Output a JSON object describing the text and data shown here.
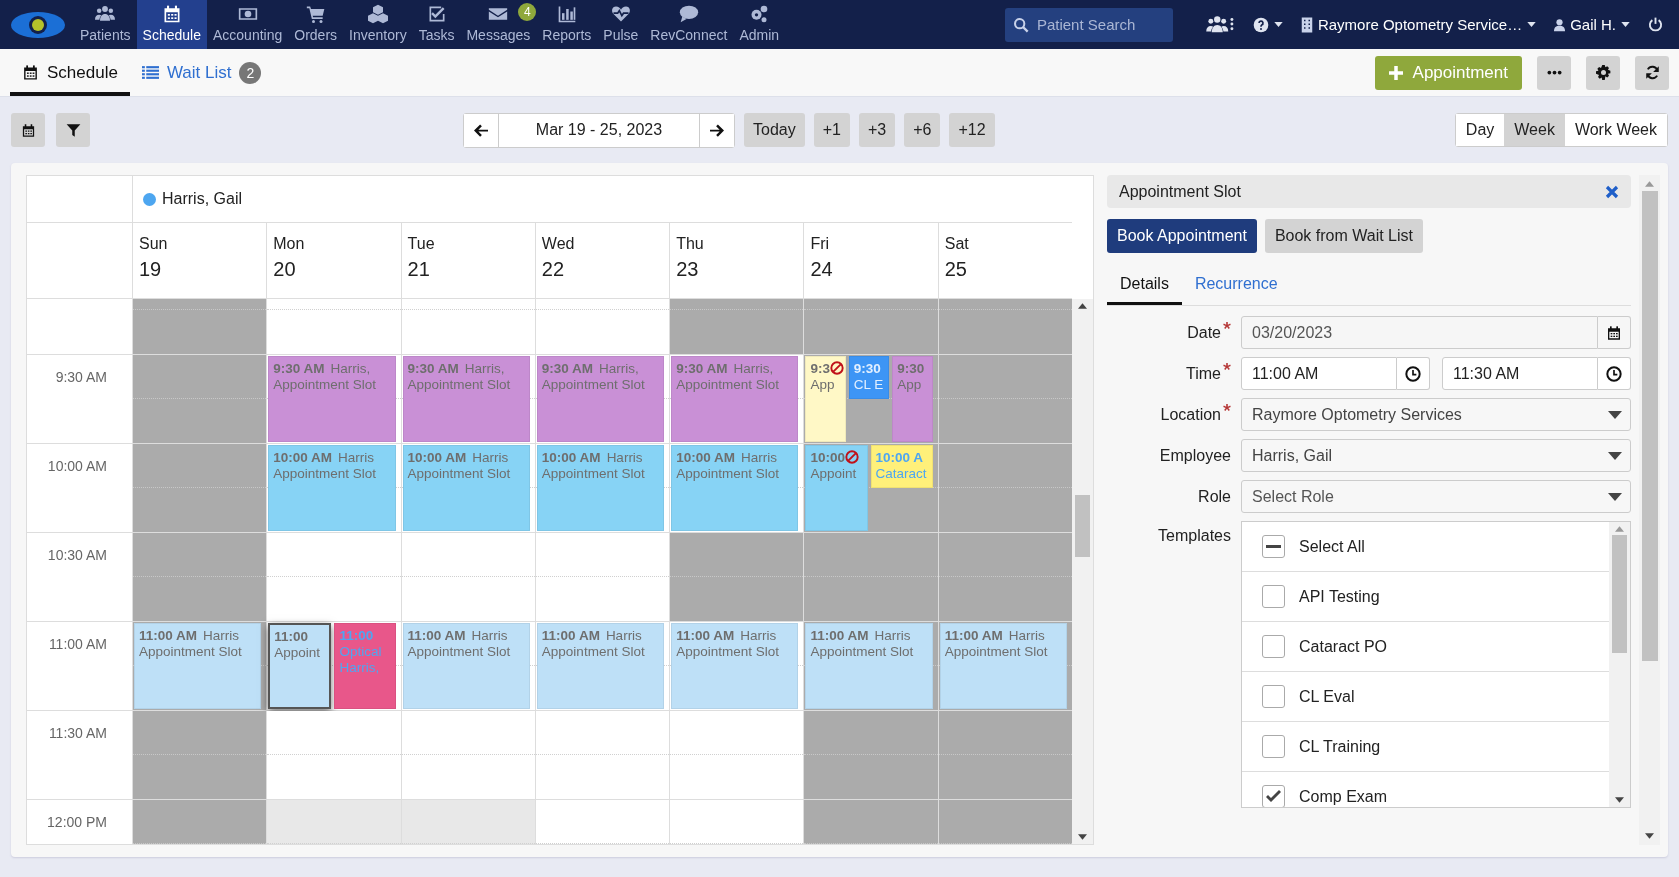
{
  "nav": {
    "items": [
      {
        "label": "Patients",
        "selected": false
      },
      {
        "label": "Schedule",
        "selected": true
      },
      {
        "label": "Accounting",
        "selected": false
      },
      {
        "label": "Orders",
        "selected": false
      },
      {
        "label": "Inventory",
        "selected": false
      },
      {
        "label": "Tasks",
        "selected": false
      },
      {
        "label": "Messages",
        "selected": false,
        "badge": "4"
      },
      {
        "label": "Reports",
        "selected": false
      },
      {
        "label": "Pulse",
        "selected": false
      },
      {
        "label": "RevConnect",
        "selected": false
      },
      {
        "label": "Admin",
        "selected": false
      }
    ],
    "search": {
      "placeholder": "Patient Search"
    },
    "location": "Raymore Optometry Service…",
    "user": "Gail H."
  },
  "subtabs": [
    {
      "label": "Schedule",
      "selected": true
    },
    {
      "label": "Wait List",
      "selected": false,
      "badge": "2"
    }
  ],
  "actions": {
    "new_appointment": "Appointment"
  },
  "toolbar": {
    "range": "Mar 19 - 25, 2023",
    "today": "Today",
    "jumps": [
      "+1",
      "+3",
      "+6",
      "+12"
    ],
    "views": [
      {
        "label": "Day",
        "selected": false
      },
      {
        "label": "Week",
        "selected": true
      },
      {
        "label": "Work Week",
        "selected": false
      }
    ]
  },
  "calendar": {
    "employee": {
      "name": "Harris, Gail",
      "color": "#4da6f0"
    },
    "days": [
      {
        "name": "Sun",
        "date": "19"
      },
      {
        "name": "Mon",
        "date": "20"
      },
      {
        "name": "Tue",
        "date": "21"
      },
      {
        "name": "Wed",
        "date": "22"
      },
      {
        "name": "Thu",
        "date": "23"
      },
      {
        "name": "Fri",
        "date": "24"
      },
      {
        "name": "Sat",
        "date": "25"
      }
    ],
    "slots": [
      {
        "cells": [
          {
            "available": false
          },
          {
            "available": true
          },
          {
            "available": true
          },
          {
            "available": true
          },
          {
            "available": false
          },
          {
            "available": false
          },
          {
            "available": false
          }
        ]
      },
      {
        "label": "9:30 AM",
        "cells": [
          {
            "available": false
          },
          {
            "available": true,
            "events": [
              {
                "time": "9:30 AM",
                "name": "Harris,",
                "lines": [
                  "Appointment Slot"
                ],
                "color": "#c990d6",
                "kind": "slot",
                "selected": false,
                "blocked": false,
                "short": false
              }
            ]
          },
          {
            "available": true,
            "events": [
              {
                "time": "9:30 AM",
                "name": "Harris,",
                "lines": [
                  "Appointment Slot"
                ],
                "color": "#c990d6",
                "kind": "slot",
                "selected": false,
                "blocked": false,
                "short": false
              }
            ]
          },
          {
            "available": true,
            "events": [
              {
                "time": "9:30 AM",
                "name": "Harris,",
                "lines": [
                  "Appointment Slot"
                ],
                "color": "#c990d6",
                "kind": "slot",
                "selected": false,
                "blocked": false,
                "short": false
              }
            ]
          },
          {
            "available": true,
            "events": [
              {
                "time": "9:30 AM",
                "name": "Harris,",
                "lines": [
                  "Appointment Slot"
                ],
                "color": "#c990d6",
                "kind": "slot",
                "selected": false,
                "blocked": false,
                "short": false
              }
            ]
          },
          {
            "available": false,
            "events": [
              {
                "time": "9:3",
                "lines": [
                  "App"
                ],
                "color": "#fff8c6",
                "kind": "slot",
                "selected": false,
                "blocked": true,
                "short": false
              },
              {
                "time": "9:30",
                "lines": [
                  "CL E"
                ],
                "color": "#3d95f5",
                "kind": "booked-dark",
                "selected": false,
                "blocked": false,
                "short": true
              },
              {
                "time": "9:30",
                "lines": [
                  "App"
                ],
                "color": "#c990d6",
                "kind": "slot",
                "selected": false,
                "blocked": false,
                "short": false
              }
            ]
          },
          {
            "available": false
          }
        ]
      },
      {
        "label": "10:00 AM",
        "cells": [
          {
            "available": false
          },
          {
            "available": true,
            "events": [
              {
                "time": "10:00 AM",
                "name": "Harris",
                "lines": [
                  "Appointment Slot"
                ],
                "color": "#87d3f5",
                "kind": "slot",
                "selected": false,
                "blocked": false,
                "short": false
              }
            ]
          },
          {
            "available": true,
            "events": [
              {
                "time": "10:00 AM",
                "name": "Harris",
                "lines": [
                  "Appointment Slot"
                ],
                "color": "#87d3f5",
                "kind": "slot",
                "selected": false,
                "blocked": false,
                "short": false
              }
            ]
          },
          {
            "available": true,
            "events": [
              {
                "time": "10:00 AM",
                "name": "Harris",
                "lines": [
                  "Appointment Slot"
                ],
                "color": "#87d3f5",
                "kind": "slot",
                "selected": false,
                "blocked": false,
                "short": false
              }
            ]
          },
          {
            "available": true,
            "events": [
              {
                "time": "10:00 AM",
                "name": "Harris",
                "lines": [
                  "Appointment Slot"
                ],
                "color": "#87d3f5",
                "kind": "slot",
                "selected": false,
                "blocked": false,
                "short": false
              }
            ]
          },
          {
            "available": false,
            "events": [
              {
                "time": "10:00",
                "lines": [
                  "Appoint"
                ],
                "color": "#87d3f5",
                "kind": "slot",
                "selected": false,
                "blocked": true,
                "short": false
              },
              {
                "time": "10:00 A",
                "lines": [
                  "Cataract"
                ],
                "color": "#fff07a",
                "kind": "booked",
                "selected": false,
                "blocked": false,
                "short": true
              }
            ]
          },
          {
            "available": false
          }
        ]
      },
      {
        "label": "10:30 AM",
        "cells": [
          {
            "available": false
          },
          {
            "available": true
          },
          {
            "available": true
          },
          {
            "available": true
          },
          {
            "available": false
          },
          {
            "available": false
          },
          {
            "available": false
          }
        ]
      },
      {
        "label": "11:00 AM",
        "cells": [
          {
            "available": false,
            "events": [
              {
                "time": "11:00 AM",
                "name": "Harris",
                "lines": [
                  "Appointment Slot"
                ],
                "color": "#bee0f7",
                "kind": "slot",
                "selected": false,
                "blocked": false,
                "short": false
              }
            ]
          },
          {
            "available": true,
            "events": [
              {
                "time": "11:00",
                "lines": [
                  "Appoint"
                ],
                "color": "#bee0f7",
                "kind": "slot",
                "selected": true,
                "blocked": false,
                "short": false
              },
              {
                "time": "11:00",
                "lines": [
                  "Optical",
                  "Harris,"
                ],
                "color": "#e8578a",
                "kind": "booked",
                "selected": false,
                "blocked": false,
                "short": false
              }
            ]
          },
          {
            "available": true,
            "events": [
              {
                "time": "11:00 AM",
                "name": "Harris",
                "lines": [
                  "Appointment Slot"
                ],
                "color": "#bee0f7",
                "kind": "slot",
                "selected": false,
                "blocked": false,
                "short": false
              }
            ]
          },
          {
            "available": true,
            "events": [
              {
                "time": "11:00 AM",
                "name": "Harris",
                "lines": [
                  "Appointment Slot"
                ],
                "color": "#bee0f7",
                "kind": "slot",
                "selected": false,
                "blocked": false,
                "short": false
              }
            ]
          },
          {
            "available": true,
            "events": [
              {
                "time": "11:00 AM",
                "name": "Harris",
                "lines": [
                  "Appointment Slot"
                ],
                "color": "#bee0f7",
                "kind": "slot",
                "selected": false,
                "blocked": false,
                "short": false
              }
            ]
          },
          {
            "available": false,
            "events": [
              {
                "time": "11:00 AM",
                "name": "Harris",
                "lines": [
                  "Appointment Slot"
                ],
                "color": "#bee0f7",
                "kind": "slot",
                "selected": false,
                "blocked": false,
                "short": false
              }
            ]
          },
          {
            "available": false,
            "events": [
              {
                "time": "11:00 AM",
                "name": "Harris",
                "lines": [
                  "Appointment Slot"
                ],
                "color": "#bee0f7",
                "kind": "slot",
                "selected": false,
                "blocked": false,
                "short": false
              }
            ]
          }
        ]
      },
      {
        "label": "11:30 AM",
        "cells": [
          {
            "available": false
          },
          {
            "available": true
          },
          {
            "available": true
          },
          {
            "available": true
          },
          {
            "available": true
          },
          {
            "available": false
          },
          {
            "available": false
          }
        ]
      },
      {
        "label": "12:00 PM",
        "cells": [
          {
            "available": false
          },
          {
            "available": true,
            "dimmed": true
          },
          {
            "available": true,
            "dimmed": true
          },
          {
            "available": true
          },
          {
            "available": true
          },
          {
            "available": false
          },
          {
            "available": false
          }
        ]
      }
    ]
  },
  "panel": {
    "title": "Appointment Slot",
    "buttons": [
      {
        "label": "Book Appointment",
        "kind": "primary"
      },
      {
        "label": "Book from Wait List",
        "kind": "secondary"
      }
    ],
    "tabs": [
      {
        "label": "Details",
        "selected": true
      },
      {
        "label": "Recurrence",
        "selected": false
      }
    ],
    "fields": [
      {
        "label": "Date",
        "required": true,
        "kind": "date",
        "value": "03/20/2023"
      },
      {
        "label": "Time",
        "required": true,
        "kind": "time",
        "value": "11:00 AM",
        "end_value": "11:30 AM"
      },
      {
        "label": "Location",
        "required": true,
        "kind": "select",
        "value": "Raymore Optometry Services"
      },
      {
        "label": "Employee",
        "kind": "select",
        "value": "Harris, Gail"
      },
      {
        "label": "Role",
        "kind": "select",
        "placeholder": "Select Role"
      }
    ],
    "templates": {
      "label": "Templates",
      "select_all": {
        "label": "Select All",
        "indeterminate": true
      },
      "options": [
        {
          "label": "API Testing",
          "checked": false
        },
        {
          "label": "Cataract PO",
          "checked": false
        },
        {
          "label": "CL Eval",
          "checked": false
        },
        {
          "label": "CL Training",
          "checked": false
        },
        {
          "label": "Comp Exam",
          "checked": true
        }
      ]
    }
  }
}
